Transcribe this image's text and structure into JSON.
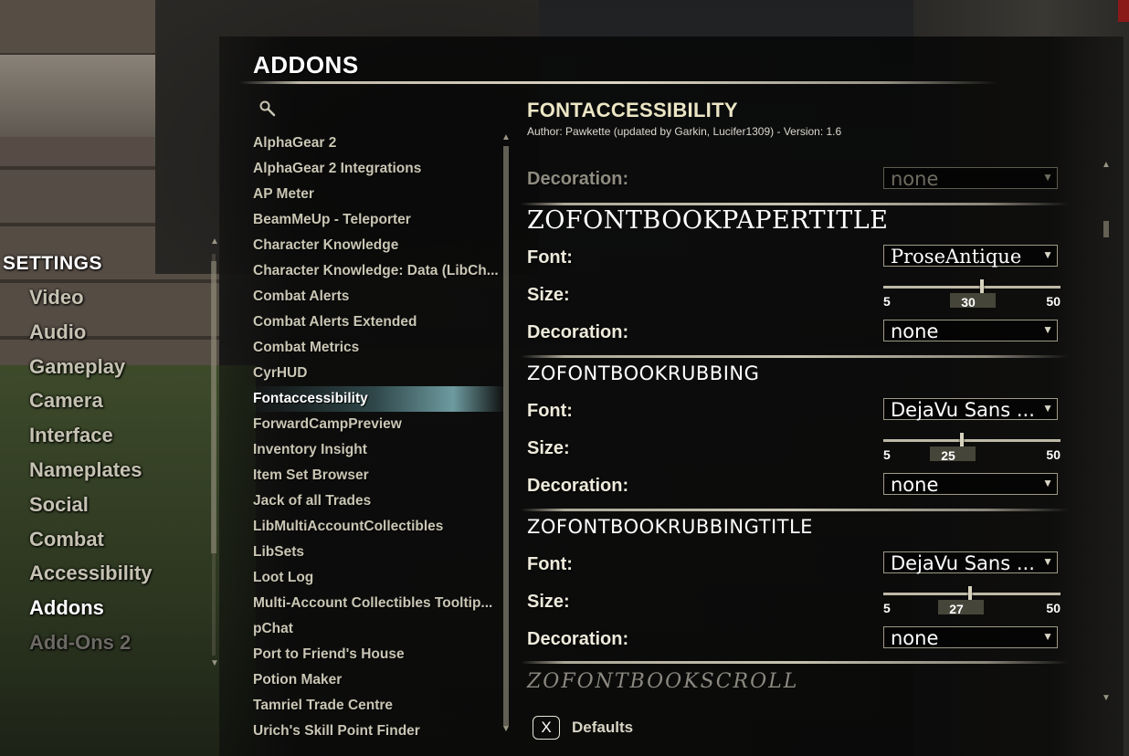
{
  "settings": {
    "title": "SETTINGS",
    "items": [
      {
        "label": "Video",
        "state": "normal"
      },
      {
        "label": "Audio",
        "state": "normal"
      },
      {
        "label": "Gameplay",
        "state": "normal"
      },
      {
        "label": "Camera",
        "state": "normal"
      },
      {
        "label": "Interface",
        "state": "normal"
      },
      {
        "label": "Nameplates",
        "state": "normal"
      },
      {
        "label": "Social",
        "state": "normal"
      },
      {
        "label": "Combat",
        "state": "normal"
      },
      {
        "label": "Accessibility",
        "state": "normal"
      },
      {
        "label": "Addons",
        "state": "active"
      },
      {
        "label": "Add-Ons 2",
        "state": "disabled"
      }
    ]
  },
  "addons": {
    "title": "ADDONS",
    "search_icon": "search-icon",
    "list": [
      {
        "label": "AlphaGear 2"
      },
      {
        "label": "AlphaGear 2 Integrations"
      },
      {
        "label": "AP Meter"
      },
      {
        "label": "BeamMeUp - Teleporter"
      },
      {
        "label": "Character Knowledge"
      },
      {
        "label": "Character Knowledge: Data (LibCh..."
      },
      {
        "label": "Combat Alerts"
      },
      {
        "label": "Combat Alerts Extended"
      },
      {
        "label": "Combat Metrics"
      },
      {
        "label": "CyrHUD"
      },
      {
        "label": "Fontaccessibility",
        "selected": true
      },
      {
        "label": "ForwardCampPreview"
      },
      {
        "label": "Inventory Insight"
      },
      {
        "label": "Item Set Browser"
      },
      {
        "label": "Jack of all Trades"
      },
      {
        "label": "LibMultiAccountCollectibles"
      },
      {
        "label": "LibSets"
      },
      {
        "label": "Loot Log"
      },
      {
        "label": "Multi-Account Collectibles Tooltip..."
      },
      {
        "label": "pChat"
      },
      {
        "label": "Port to Friend's House"
      },
      {
        "label": "Potion Maker"
      },
      {
        "label": "Tamriel Trade Centre"
      },
      {
        "label": "Urich's Skill Point Finder"
      }
    ]
  },
  "detail": {
    "title": "FONTACCESSIBILITY",
    "author": "Author: Pawkette (updated by Garkin, Lucifer1309) - Version: 1.6",
    "top_partial": {
      "decoration_label": "Decoration:",
      "decoration_value": "none"
    },
    "sections": [
      {
        "heading": "ZOFONTBOOKPAPERTITLE",
        "font_label": "Font:",
        "font_value": "ProseAntique",
        "size_label": "Size:",
        "size_min": "5",
        "size_max": "50",
        "size_value": "30",
        "size_fraction": 0.556,
        "decoration_label": "Decoration:",
        "decoration_value": "none"
      },
      {
        "heading": "ZOFONTBOOKRUBBING",
        "font_label": "Font:",
        "font_value": "DejaVu Sans ...",
        "size_label": "Size:",
        "size_min": "5",
        "size_max": "50",
        "size_value": "25",
        "size_fraction": 0.444,
        "decoration_label": "Decoration:",
        "decoration_value": "none"
      },
      {
        "heading": "ZOFONTBOOKRUBBINGTITLE",
        "font_label": "Font:",
        "font_value": "DejaVu Sans ...",
        "size_label": "Size:",
        "size_min": "5",
        "size_max": "50",
        "size_value": "27",
        "size_fraction": 0.489,
        "decoration_label": "Decoration:",
        "decoration_value": "none"
      }
    ],
    "next_heading": "ZOFONTBOOKSCROLL"
  },
  "footer": {
    "key_label": "X",
    "defaults_label": "Defaults"
  },
  "colors": {
    "accent_selected": "#78aaaf",
    "text_main": "#c9c6b4",
    "title": "#ece6c5"
  }
}
